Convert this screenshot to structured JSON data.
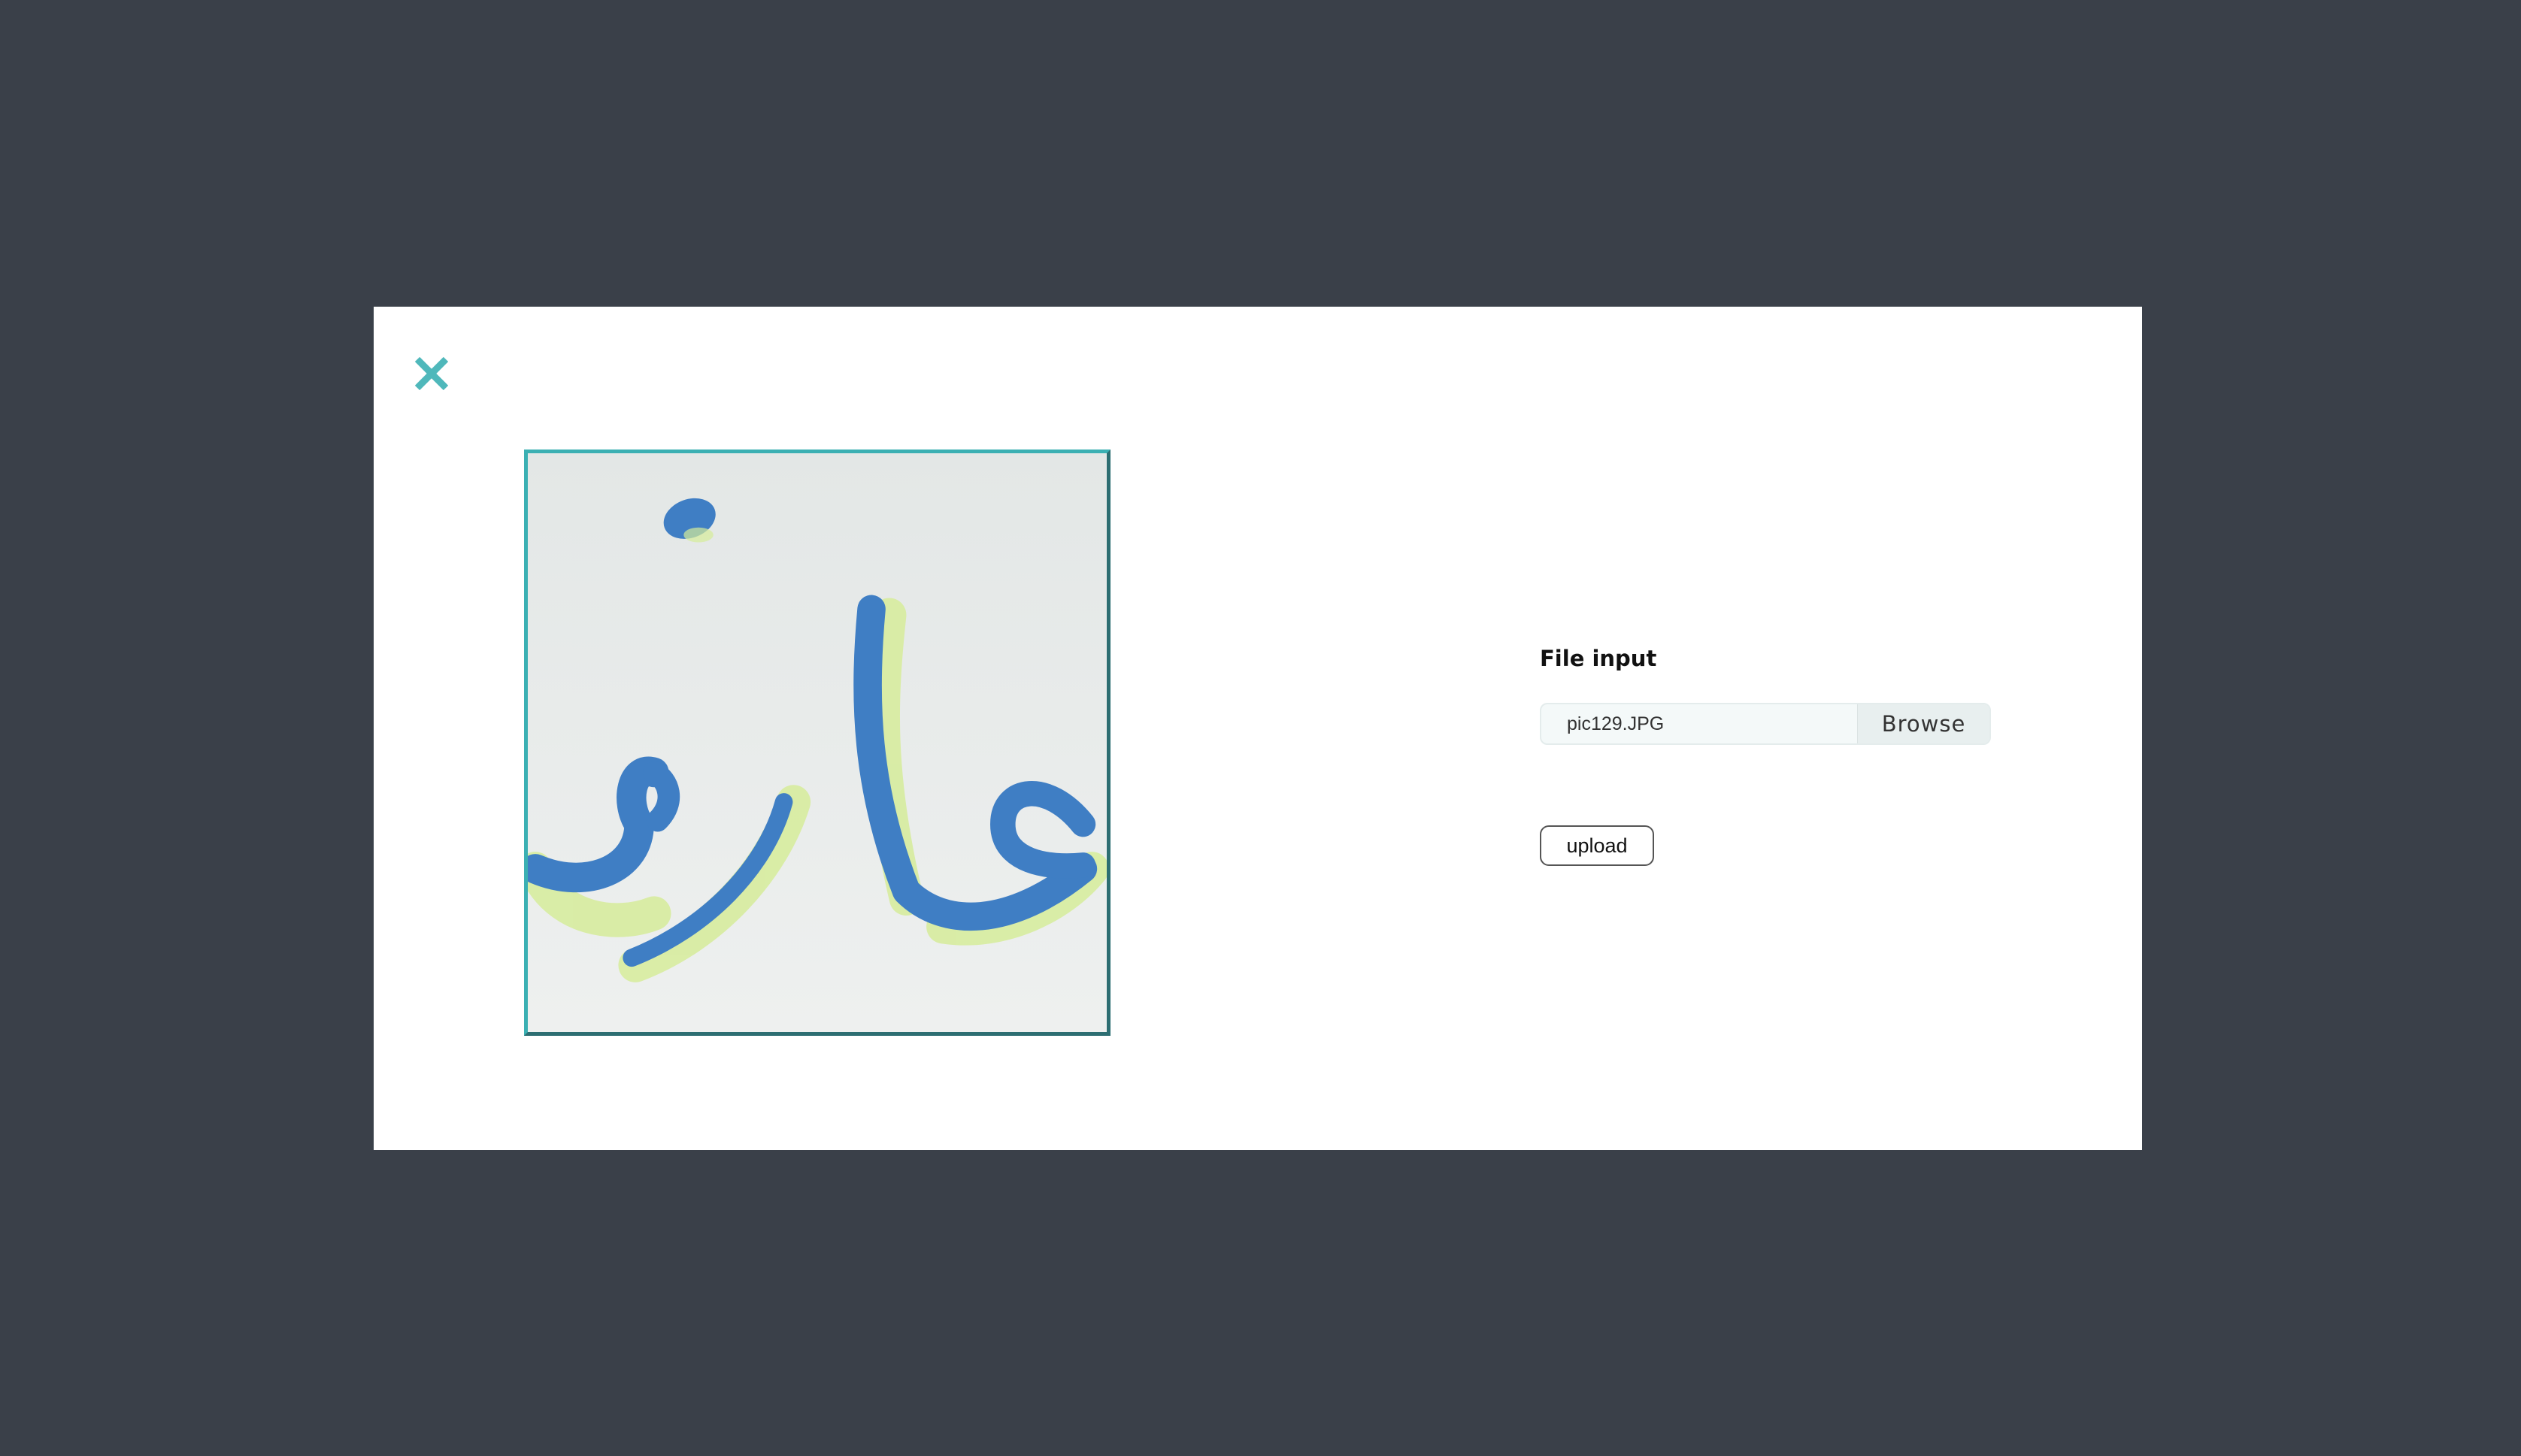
{
  "modal": {
    "close_icon": "close-icon",
    "accent_color": "#4fb8bb",
    "preview": {
      "alt": "handwritten Arabic calligraphy image preview"
    },
    "form": {
      "label": "File input",
      "file_name": "pic129.JPG",
      "browse_label": "Browse",
      "upload_label": "upload"
    }
  }
}
